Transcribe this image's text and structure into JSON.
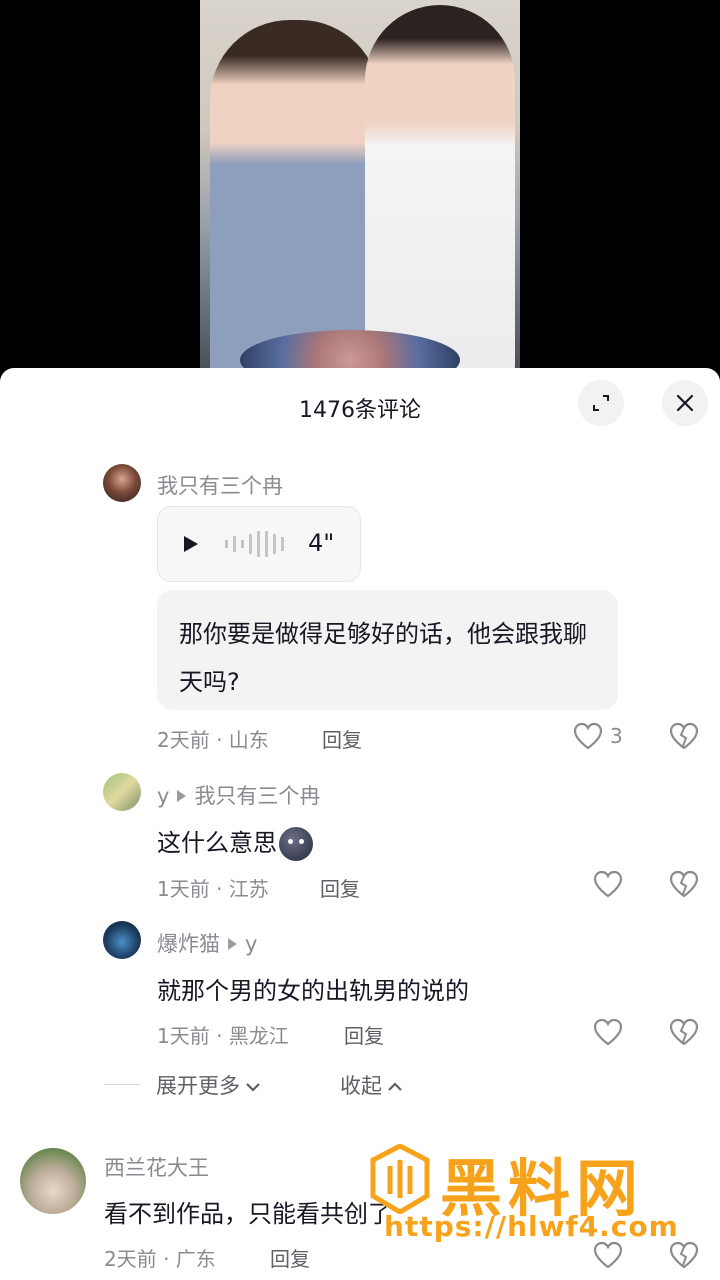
{
  "sheet": {
    "title": "1476条评论"
  },
  "comments": [
    {
      "username": "我只有三个冉",
      "voice_duration": "4\"",
      "text": "那你要是做得足够好的话，他会跟我聊天吗?",
      "meta": "2天前 · 山东",
      "reply_label": "回复",
      "likes": "3"
    },
    {
      "username": "y",
      "reply_to": "我只有三个冉",
      "text": "这什么意思",
      "meta": "1天前 · 江苏",
      "reply_label": "回复"
    },
    {
      "username": "爆炸猫",
      "reply_to": "y",
      "text": "就那个男的女的出轨男的说的",
      "meta": "1天前 · 黑龙江",
      "reply_label": "回复"
    },
    {
      "username": "西兰花大王",
      "text": "看不到作品，只能看共创了",
      "meta": "2天前 · 广东",
      "reply_label": "回复"
    }
  ],
  "thread_controls": {
    "expand_more": "展开更多",
    "collapse": "收起"
  },
  "watermark": {
    "title": "黑料网",
    "url": "https://hlwf4.com"
  },
  "colors": {
    "accent_watermark": "#f7a21b",
    "text_primary": "#161823",
    "text_secondary": "#8a8b91"
  }
}
